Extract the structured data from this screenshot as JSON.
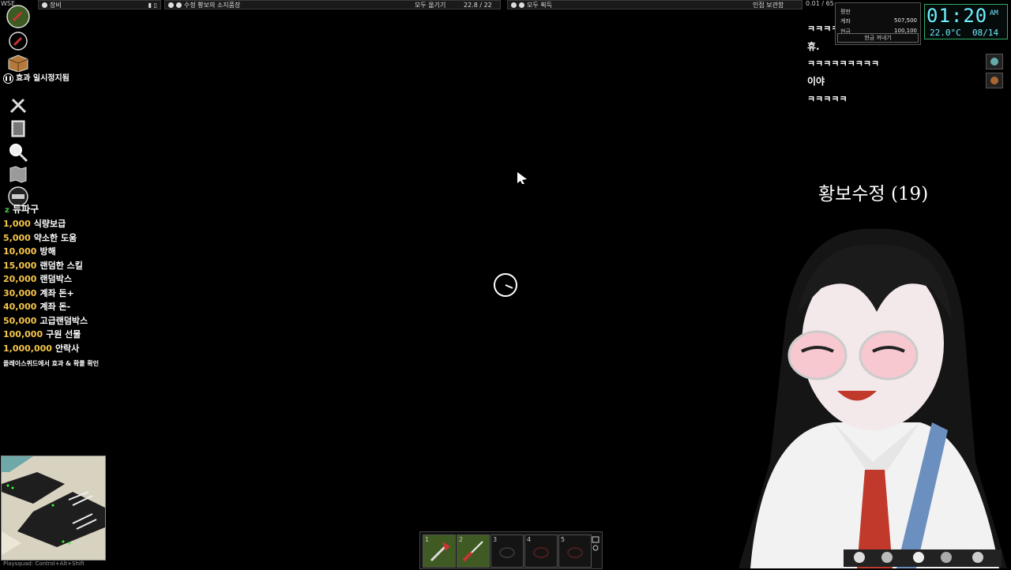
{
  "top_left_tag": "WSE",
  "top_bars": {
    "equipment": {
      "label": "장비"
    },
    "container": {
      "label": "수정 황보의 소지품장",
      "move_all": "모두 옮기기",
      "weight": "22.8 / 22"
    },
    "ground": {
      "label": "모두 획득",
      "nearby": "인접 보관함",
      "weight": "0.01 / 65"
    }
  },
  "effects_paused": "효과 일시정지됨",
  "donation_header": "듀파구",
  "donations": [
    {
      "amount": "1,000",
      "label": "식량보급"
    },
    {
      "amount": "5,000",
      "label": "약소한 도움"
    },
    {
      "amount": "10,000",
      "label": "방해"
    },
    {
      "amount": "15,000",
      "label": "랜덤한 스킬"
    },
    {
      "amount": "20,000",
      "label": "랜덤박스"
    },
    {
      "amount": "30,000",
      "label": "계좌 돈+"
    },
    {
      "amount": "40,000",
      "label": "계좌 돈-"
    },
    {
      "amount": "50,000",
      "label": "고급랜덤박스"
    },
    {
      "amount": "100,000",
      "label": "구원 선물"
    },
    {
      "amount": "1,000,000",
      "label": "안락사"
    }
  ],
  "donation_note": "플레이스퀴드에서 효과 & 확률 확인",
  "money_panel": {
    "rating": "평판",
    "account_label": "계좌",
    "account_value": "507,500",
    "cash_label": "현금",
    "cash_value": "100,100",
    "withdraw_button": "현금 꺼내기"
  },
  "clock": {
    "time": "01:20",
    "ampm": "AM",
    "temp": "22.0°C",
    "date": "08/14"
  },
  "chat": [
    "ㅋㅋㅋㅋㅋㅋㅋㅋㅋ",
    "휴.",
    "ㅋㅋㅋㅋㅋㅋㅋㅋㅋ",
    "이야",
    "ㅋㅋㅋㅋㅋ"
  ],
  "overlay_title": "황보수정 (19)",
  "hotbar": [
    {
      "slot": "1",
      "item": "axe"
    },
    {
      "slot": "2",
      "item": "screwdriver"
    },
    {
      "slot": "3",
      "item": ""
    },
    {
      "slot": "4",
      "item": ""
    },
    {
      "slot": "5",
      "item": ""
    }
  ],
  "bottom_hint": "Playsquad: Control+Alt+Shift",
  "colors": {
    "amount": "#f6c64a",
    "clock": "#6ff0ff",
    "background": "#000000"
  }
}
